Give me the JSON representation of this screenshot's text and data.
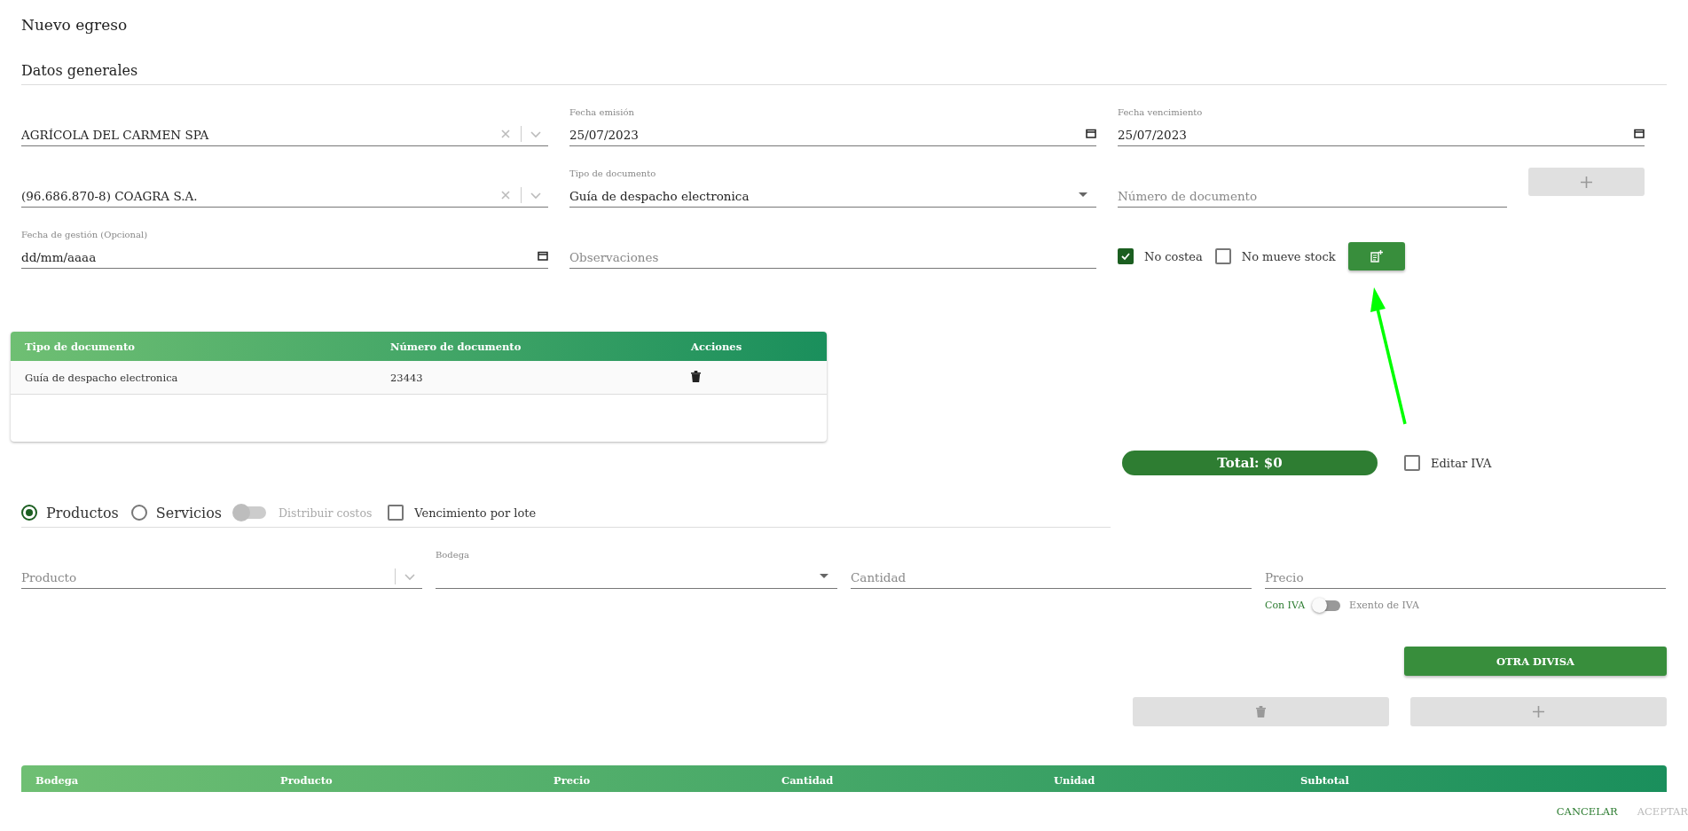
{
  "title": "Nuevo egreso",
  "section": "Datos generales",
  "general": {
    "cliente": {
      "value": "AGRÍCOLA DEL CARMEN SPA"
    },
    "fecha_emision": {
      "label": "Fecha emisión",
      "value": "25/07/2023"
    },
    "fecha_vencimiento": {
      "label": "Fecha vencimiento",
      "value": "25/07/2023"
    },
    "proveedor": {
      "value": "(96.686.870-8) COAGRA S.A."
    },
    "tipo_documento": {
      "label": "Tipo de documento",
      "value": "Guía de despacho electronica"
    },
    "numero_documento": {
      "placeholder": "Número de documento"
    },
    "add_document": {
      "disabled": true
    },
    "fecha_gestion": {
      "label": "Fecha de gestión (Opcional)",
      "value": "dd/mm/aaaa"
    },
    "observaciones": {
      "placeholder": "Observaciones"
    },
    "options": [
      {
        "label": "No costea",
        "checked": true
      },
      {
        "label": "No mueve stock",
        "checked": false
      }
    ]
  },
  "documents_table": {
    "columns": [
      "Tipo de documento",
      "Número de documento",
      "Acciones"
    ],
    "rows": [
      {
        "cells": [
          "Guía de despacho electronica",
          "23443"
        ]
      }
    ]
  },
  "total": "Total: $0",
  "edit_iva": {
    "label": "Editar IVA",
    "checked": false
  },
  "item_types": [
    {
      "label": "Productos",
      "selected": true
    },
    {
      "label": "Servicios",
      "selected": false
    }
  ],
  "distribute_costs": {
    "label": "Distribuir costos",
    "on": false,
    "disabled": true
  },
  "lot_expiry": {
    "label": "Vencimiento por lote",
    "checked": false
  },
  "item_form": {
    "producto": {
      "placeholder": "Producto"
    },
    "bodega": {
      "label": "Bodega"
    },
    "cantidad": {
      "placeholder": "Cantidad"
    },
    "precio": {
      "placeholder": "Precio"
    },
    "iva_toggle": {
      "left": "Con IVA",
      "right": "Exento de IVA",
      "on": false
    }
  },
  "other_currency": "OTRA DIVISA",
  "item_buttons": [
    {
      "kind": "delete",
      "disabled": true
    },
    {
      "kind": "add",
      "disabled": true
    }
  ],
  "items_table": {
    "columns": [
      "Bodega",
      "Producto",
      "Precio",
      "Cantidad",
      "Unidad",
      "Subtotal"
    ]
  },
  "footer": [
    {
      "label": "CANCELAR",
      "disabled": false
    },
    {
      "label": "ACEPTAR",
      "disabled": true
    }
  ]
}
